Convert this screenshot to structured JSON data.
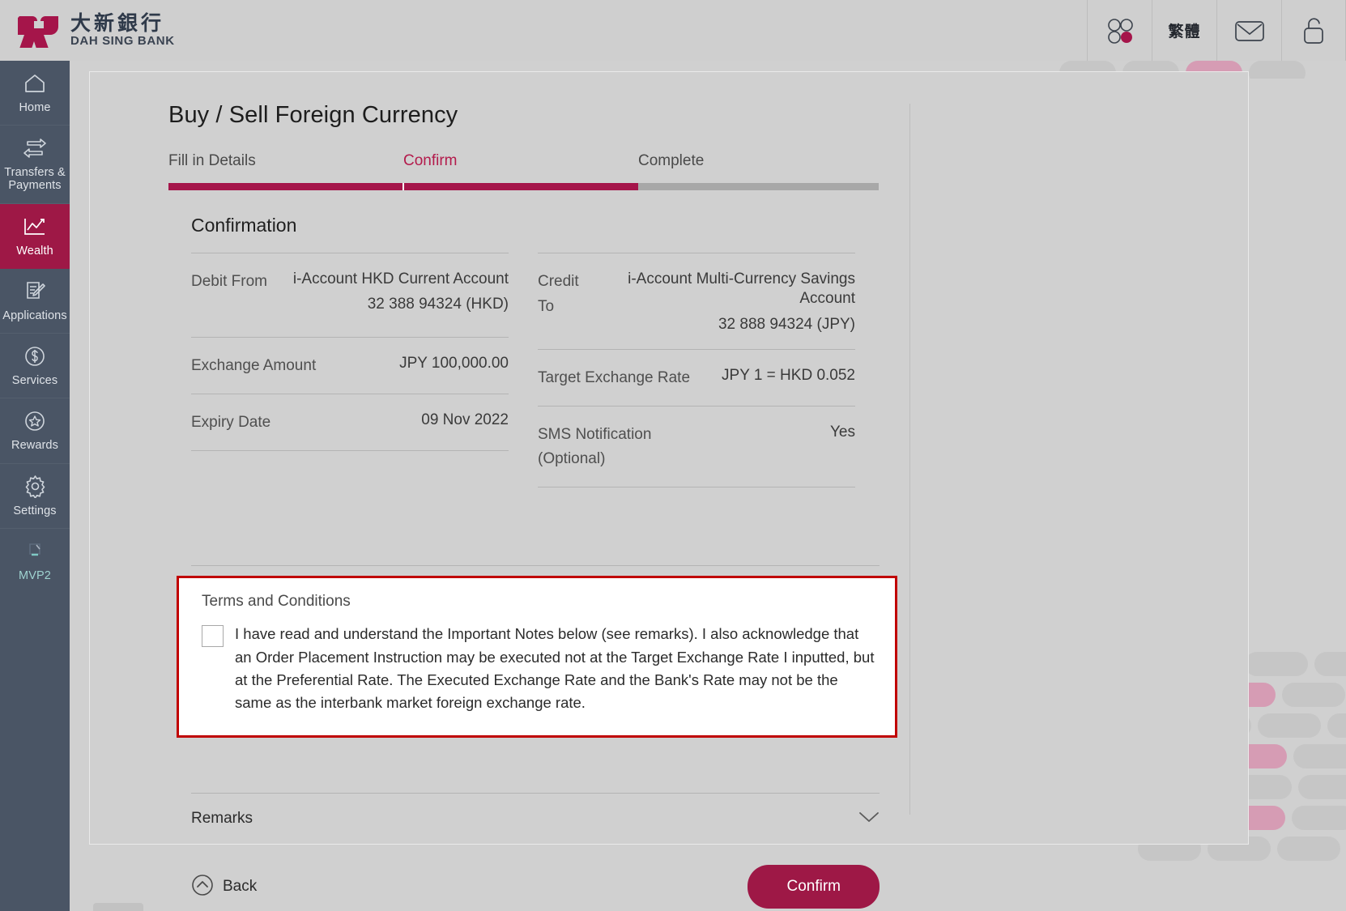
{
  "header": {
    "logo_cn": "大新銀行",
    "logo_en": "DAH SING BANK",
    "apps_icon": "apps-grid-icon",
    "language_label": "繁體",
    "mail_icon": "mail-icon",
    "lock_icon": "lock-icon"
  },
  "sidebar": {
    "items": [
      {
        "label": "Home",
        "icon": "home-icon",
        "active": false
      },
      {
        "label": "Transfers & Payments",
        "icon": "transfer-arrows-icon",
        "active": false
      },
      {
        "label": "Wealth",
        "icon": "chart-line-icon",
        "active": true
      },
      {
        "label": "Applications",
        "icon": "document-pencil-icon",
        "active": false
      },
      {
        "label": "Services",
        "icon": "dollar-circle-icon",
        "active": false
      },
      {
        "label": "Rewards",
        "icon": "star-circle-icon",
        "active": false
      },
      {
        "label": "Settings",
        "icon": "gear-icon",
        "active": false
      },
      {
        "label": "MVP2",
        "icon": "mvp-icon",
        "active": false
      }
    ]
  },
  "page": {
    "title": "Buy / Sell Foreign Currency",
    "steps": [
      {
        "label": "Fill in Details",
        "state": "done"
      },
      {
        "label": "Confirm",
        "state": "current"
      },
      {
        "label": "Complete",
        "state": "pending"
      }
    ],
    "section_title": "Confirmation",
    "rows_left": [
      {
        "label": "Debit From",
        "value": "i-Account HKD Current Account",
        "account": "32 388 94324 (HKD)"
      },
      {
        "label": "Exchange Amount",
        "value": "JPY 100,000.00",
        "account": ""
      },
      {
        "label": "Expiry Date",
        "value": "09 Nov 2022",
        "account": ""
      }
    ],
    "rows_right": [
      {
        "label": "Credit To",
        "value": "i-Account Multi-Currency Savings Account",
        "account": "32 888 94324 (JPY)"
      },
      {
        "label": "Target Exchange Rate",
        "value": "JPY 1 = HKD 0.052",
        "account": ""
      },
      {
        "label": "SMS Notification (Optional)",
        "value": "Yes",
        "account": ""
      }
    ],
    "terms": {
      "title": "Terms and Conditions",
      "checkbox_checked": false,
      "text": "I have read and understand the Important Notes below (see remarks). I also acknowledge that an Order Placement Instruction may be executed not at the Target Exchange Rate I inputted, but at the Preferential Rate. The Executed Exchange Rate and the Bank's Rate may not be the same as the interbank market foreign exchange rate."
    },
    "remarks": {
      "label": "Remarks",
      "chevron_icon": "chevron-down-icon"
    },
    "actions": {
      "back_label": "Back",
      "back_icon": "chevron-up-circle-icon",
      "confirm_label": "Confirm"
    }
  },
  "colors": {
    "brand_crimson": "#9e1846",
    "step_current": "#b31b4c",
    "sidebar_bg": "#4a5565",
    "page_bg": "#d0d0d0",
    "alert_border": "#c00000",
    "decor_pink": "#d69cb4",
    "decor_gray": "#c6c6c6"
  }
}
